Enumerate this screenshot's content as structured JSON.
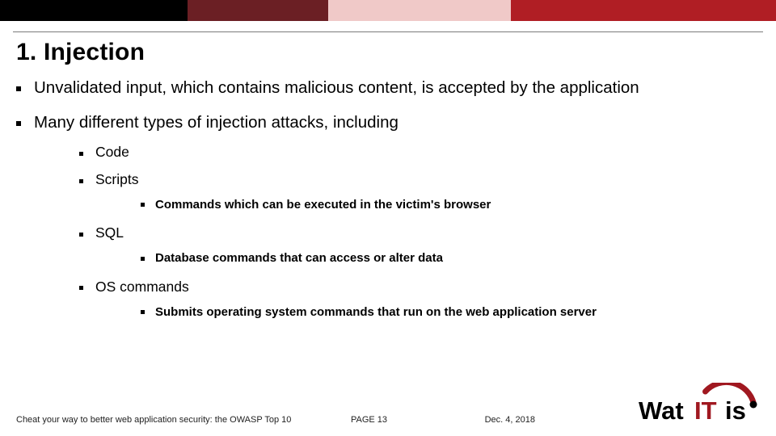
{
  "title": "1. Injection",
  "bullets": {
    "b1": "Unvalidated input, which contains malicious content, is accepted by the application",
    "b2": "Many different types of injection attacks, including",
    "s1": "Code",
    "s2": "Scripts",
    "s2a": "Commands which can be executed in the victim's browser",
    "s3": "SQL",
    "s3a": "Database commands that can access or alter data",
    "s4": "OS commands",
    "s4a": "Submits operating system commands that run on the web application server"
  },
  "footer": {
    "left": "Cheat your way to better web application security: the OWASP Top 10",
    "page_label": "PAGE  13",
    "date": "Dec. 4, 2018"
  },
  "logo": {
    "name": "WatITis"
  }
}
